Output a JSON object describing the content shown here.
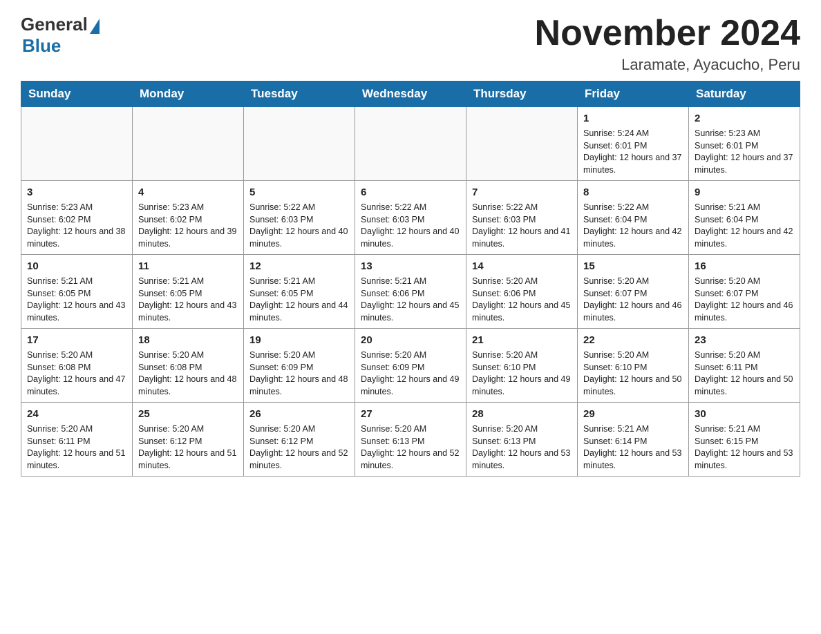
{
  "header": {
    "logo_general": "General",
    "logo_blue": "Blue",
    "month_title": "November 2024",
    "location": "Laramate, Ayacucho, Peru"
  },
  "days_of_week": [
    "Sunday",
    "Monday",
    "Tuesday",
    "Wednesday",
    "Thursday",
    "Friday",
    "Saturday"
  ],
  "weeks": [
    [
      {
        "day": "",
        "sunrise": "",
        "sunset": "",
        "daylight": ""
      },
      {
        "day": "",
        "sunrise": "",
        "sunset": "",
        "daylight": ""
      },
      {
        "day": "",
        "sunrise": "",
        "sunset": "",
        "daylight": ""
      },
      {
        "day": "",
        "sunrise": "",
        "sunset": "",
        "daylight": ""
      },
      {
        "day": "",
        "sunrise": "",
        "sunset": "",
        "daylight": ""
      },
      {
        "day": "1",
        "sunrise": "Sunrise: 5:24 AM",
        "sunset": "Sunset: 6:01 PM",
        "daylight": "Daylight: 12 hours and 37 minutes."
      },
      {
        "day": "2",
        "sunrise": "Sunrise: 5:23 AM",
        "sunset": "Sunset: 6:01 PM",
        "daylight": "Daylight: 12 hours and 37 minutes."
      }
    ],
    [
      {
        "day": "3",
        "sunrise": "Sunrise: 5:23 AM",
        "sunset": "Sunset: 6:02 PM",
        "daylight": "Daylight: 12 hours and 38 minutes."
      },
      {
        "day": "4",
        "sunrise": "Sunrise: 5:23 AM",
        "sunset": "Sunset: 6:02 PM",
        "daylight": "Daylight: 12 hours and 39 minutes."
      },
      {
        "day": "5",
        "sunrise": "Sunrise: 5:22 AM",
        "sunset": "Sunset: 6:03 PM",
        "daylight": "Daylight: 12 hours and 40 minutes."
      },
      {
        "day": "6",
        "sunrise": "Sunrise: 5:22 AM",
        "sunset": "Sunset: 6:03 PM",
        "daylight": "Daylight: 12 hours and 40 minutes."
      },
      {
        "day": "7",
        "sunrise": "Sunrise: 5:22 AM",
        "sunset": "Sunset: 6:03 PM",
        "daylight": "Daylight: 12 hours and 41 minutes."
      },
      {
        "day": "8",
        "sunrise": "Sunrise: 5:22 AM",
        "sunset": "Sunset: 6:04 PM",
        "daylight": "Daylight: 12 hours and 42 minutes."
      },
      {
        "day": "9",
        "sunrise": "Sunrise: 5:21 AM",
        "sunset": "Sunset: 6:04 PM",
        "daylight": "Daylight: 12 hours and 42 minutes."
      }
    ],
    [
      {
        "day": "10",
        "sunrise": "Sunrise: 5:21 AM",
        "sunset": "Sunset: 6:05 PM",
        "daylight": "Daylight: 12 hours and 43 minutes."
      },
      {
        "day": "11",
        "sunrise": "Sunrise: 5:21 AM",
        "sunset": "Sunset: 6:05 PM",
        "daylight": "Daylight: 12 hours and 43 minutes."
      },
      {
        "day": "12",
        "sunrise": "Sunrise: 5:21 AM",
        "sunset": "Sunset: 6:05 PM",
        "daylight": "Daylight: 12 hours and 44 minutes."
      },
      {
        "day": "13",
        "sunrise": "Sunrise: 5:21 AM",
        "sunset": "Sunset: 6:06 PM",
        "daylight": "Daylight: 12 hours and 45 minutes."
      },
      {
        "day": "14",
        "sunrise": "Sunrise: 5:20 AM",
        "sunset": "Sunset: 6:06 PM",
        "daylight": "Daylight: 12 hours and 45 minutes."
      },
      {
        "day": "15",
        "sunrise": "Sunrise: 5:20 AM",
        "sunset": "Sunset: 6:07 PM",
        "daylight": "Daylight: 12 hours and 46 minutes."
      },
      {
        "day": "16",
        "sunrise": "Sunrise: 5:20 AM",
        "sunset": "Sunset: 6:07 PM",
        "daylight": "Daylight: 12 hours and 46 minutes."
      }
    ],
    [
      {
        "day": "17",
        "sunrise": "Sunrise: 5:20 AM",
        "sunset": "Sunset: 6:08 PM",
        "daylight": "Daylight: 12 hours and 47 minutes."
      },
      {
        "day": "18",
        "sunrise": "Sunrise: 5:20 AM",
        "sunset": "Sunset: 6:08 PM",
        "daylight": "Daylight: 12 hours and 48 minutes."
      },
      {
        "day": "19",
        "sunrise": "Sunrise: 5:20 AM",
        "sunset": "Sunset: 6:09 PM",
        "daylight": "Daylight: 12 hours and 48 minutes."
      },
      {
        "day": "20",
        "sunrise": "Sunrise: 5:20 AM",
        "sunset": "Sunset: 6:09 PM",
        "daylight": "Daylight: 12 hours and 49 minutes."
      },
      {
        "day": "21",
        "sunrise": "Sunrise: 5:20 AM",
        "sunset": "Sunset: 6:10 PM",
        "daylight": "Daylight: 12 hours and 49 minutes."
      },
      {
        "day": "22",
        "sunrise": "Sunrise: 5:20 AM",
        "sunset": "Sunset: 6:10 PM",
        "daylight": "Daylight: 12 hours and 50 minutes."
      },
      {
        "day": "23",
        "sunrise": "Sunrise: 5:20 AM",
        "sunset": "Sunset: 6:11 PM",
        "daylight": "Daylight: 12 hours and 50 minutes."
      }
    ],
    [
      {
        "day": "24",
        "sunrise": "Sunrise: 5:20 AM",
        "sunset": "Sunset: 6:11 PM",
        "daylight": "Daylight: 12 hours and 51 minutes."
      },
      {
        "day": "25",
        "sunrise": "Sunrise: 5:20 AM",
        "sunset": "Sunset: 6:12 PM",
        "daylight": "Daylight: 12 hours and 51 minutes."
      },
      {
        "day": "26",
        "sunrise": "Sunrise: 5:20 AM",
        "sunset": "Sunset: 6:12 PM",
        "daylight": "Daylight: 12 hours and 52 minutes."
      },
      {
        "day": "27",
        "sunrise": "Sunrise: 5:20 AM",
        "sunset": "Sunset: 6:13 PM",
        "daylight": "Daylight: 12 hours and 52 minutes."
      },
      {
        "day": "28",
        "sunrise": "Sunrise: 5:20 AM",
        "sunset": "Sunset: 6:13 PM",
        "daylight": "Daylight: 12 hours and 53 minutes."
      },
      {
        "day": "29",
        "sunrise": "Sunrise: 5:21 AM",
        "sunset": "Sunset: 6:14 PM",
        "daylight": "Daylight: 12 hours and 53 minutes."
      },
      {
        "day": "30",
        "sunrise": "Sunrise: 5:21 AM",
        "sunset": "Sunset: 6:15 PM",
        "daylight": "Daylight: 12 hours and 53 minutes."
      }
    ]
  ]
}
